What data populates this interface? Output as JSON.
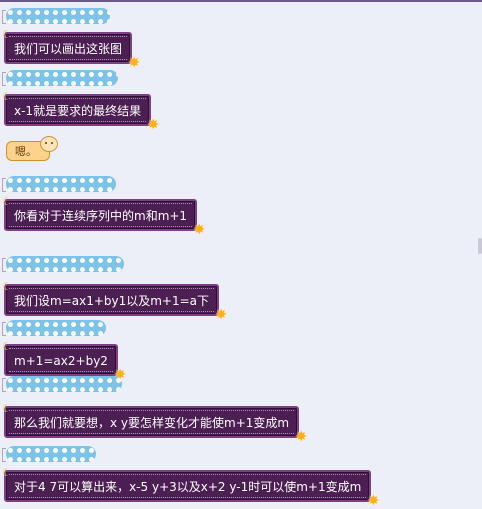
{
  "messages": [
    "我们可以画出这张图",
    "x-1就是要求的最终结果",
    "你看对于连续序列中的m和m+1",
    "我们设m=ax1+by1以及m+1=a下",
    "m+1=ax2+by2",
    "那么我们就要想，x y要怎样变化才能使m+1变成m",
    "对于4 7可以算出来，x-5 y+3以及x+2 y-1时可以使m+1变成m"
  ],
  "sticker": {
    "text": "嗯。"
  },
  "colors": {
    "bubble_bg": "#4b1f52",
    "bubble_border": "#7e3f86",
    "name_bg": "#7cc3ea",
    "page_bg": "#eceef8"
  },
  "icons": {
    "moon": "crescent-moon-icon",
    "star": "sparkle-star-icon"
  }
}
